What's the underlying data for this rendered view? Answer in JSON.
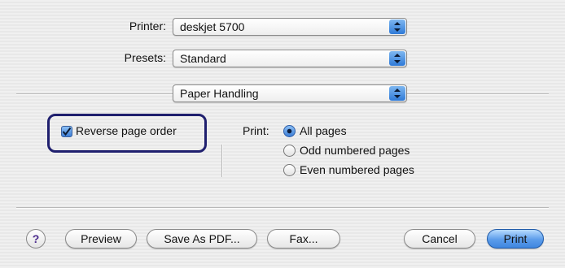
{
  "printer": {
    "label": "Printer:",
    "value": "deskjet 5700"
  },
  "presets": {
    "label": "Presets:",
    "value": "Standard"
  },
  "panel": {
    "value": "Paper Handling"
  },
  "reverse": {
    "label": "Reverse page order",
    "checked": true
  },
  "print_range": {
    "label": "Print:",
    "options": [
      "All pages",
      "Odd numbered pages",
      "Even numbered pages"
    ],
    "selected": "All pages"
  },
  "buttons": {
    "help": "?",
    "preview": "Preview",
    "save_pdf": "Save As PDF...",
    "fax": "Fax...",
    "cancel": "Cancel",
    "print": "Print"
  },
  "colors": {
    "accent": "#3f86e0",
    "highlight_border": "#1f1f6e"
  },
  "icons": {
    "popup_arrows": "updown-arrows-icon",
    "checkbox": "checkmark-icon",
    "help": "help-icon"
  }
}
